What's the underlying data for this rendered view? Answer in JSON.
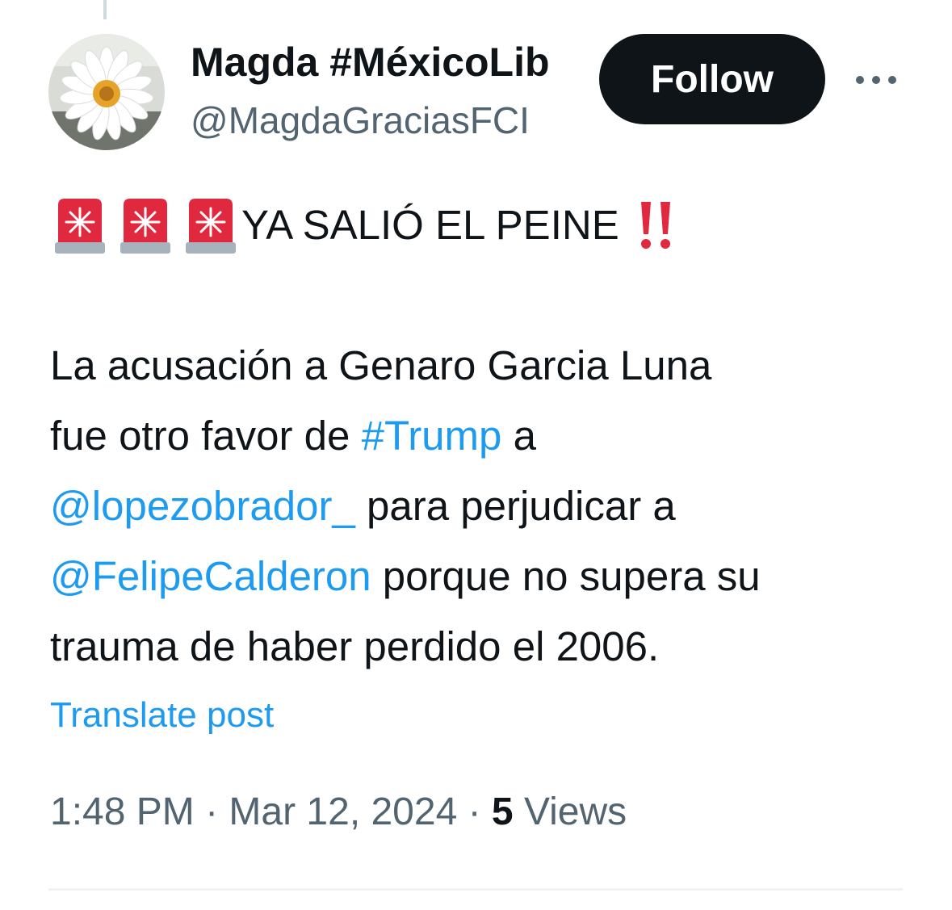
{
  "author": {
    "display_name": "Magda #MéxicoLib",
    "handle": "@MagdaGraciasFCI",
    "avatar_icon": "daisy-flower-avatar"
  },
  "actions": {
    "follow_label": "Follow",
    "more_icon": "more-dots-icon"
  },
  "post": {
    "alert_icon": "police-car-light-icon",
    "alert_icon_count": 3,
    "headline": "YA SALIÓ EL PEINE",
    "headline_end_icon": "double-exclamation-icon",
    "body": {
      "l1": "La acusación a Genaro Garcia Luna",
      "l2_a": "fue otro favor de ",
      "l2_hashtag": "#Trump",
      "l2_b": " a",
      "l3_mention": "@lopezobrador_",
      "l3_b": " para perjudicar a",
      "l4_mention": "@FelipeCalderon",
      "l4_b": " porque no supera su",
      "l5": "trauma de haber perdido el 2006."
    },
    "translate_label": "Translate post"
  },
  "meta": {
    "time": "1:48 PM",
    "separator": " · ",
    "date": "Mar 12, 2024",
    "views_count": "5",
    "views_label": " Views"
  },
  "colors": {
    "text": "#0f1419",
    "secondary": "#536471",
    "link": "#1d9bf0",
    "button_bg": "#0f1419",
    "alert_red": "#e0283e"
  }
}
